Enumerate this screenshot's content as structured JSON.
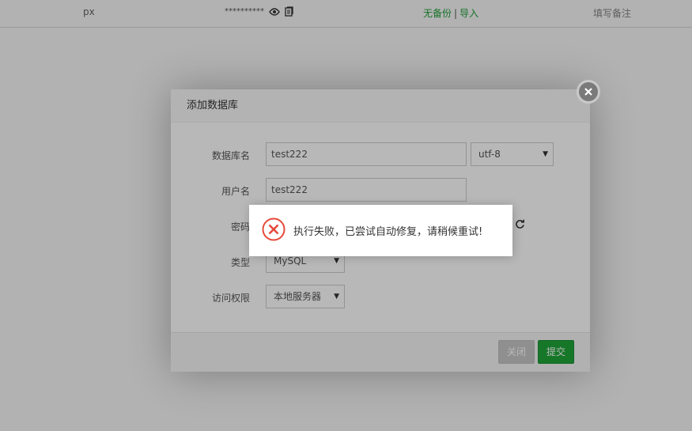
{
  "bg_row": {
    "name": "px",
    "password_mask": "**********",
    "backup_none": "无备份",
    "backup_sep": "|",
    "backup_import": "导入",
    "note_placeholder": "填写备注"
  },
  "dialog": {
    "title": "添加数据库",
    "fields": {
      "db_name_label": "数据库名",
      "db_name_value": "test222",
      "charset_value": "utf-8",
      "username_label": "用户名",
      "username_value": "test222",
      "password_label": "密码",
      "type_label": "类型",
      "type_value": "MySQL",
      "access_label": "访问权限",
      "access_value": "本地服务器"
    },
    "buttons": {
      "close_label": "关闭",
      "submit_label": "提交"
    }
  },
  "toast": {
    "message": "执行失败，已尝试自动修复，请稍候重试!"
  },
  "colors": {
    "accent_green": "#20a53a",
    "error_red": "#e64a3b"
  },
  "icons": {
    "view": "eye-icon",
    "copy": "copy-icon",
    "close": "close-icon",
    "refresh": "refresh-icon",
    "error": "error-icon"
  }
}
